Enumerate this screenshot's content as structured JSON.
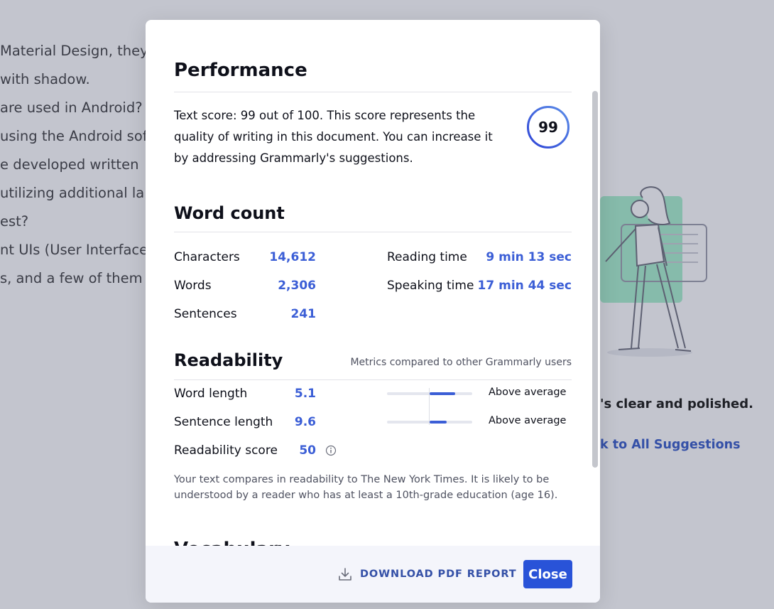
{
  "background": {
    "document_lines": [
      "Material Design, they",
      "with shadow.",
      "are used in Android?",
      "using the Android sof",
      "e developed written",
      "utilizing additional lar",
      "est?",
      "nt UIs (User Interface",
      "s, and a few of them"
    ],
    "status_message": "'s clear and polished.",
    "back_link": "k to All Suggestions"
  },
  "modal": {
    "performance": {
      "title": "Performance",
      "description": "Text score: 99 out of 100. This score represents the quality of writing in this document. You can increase it by addressing Grammarly's suggestions.",
      "score": "99",
      "score_fraction": 0.99
    },
    "word_count": {
      "title": "Word count",
      "stats": [
        {
          "label": "Characters",
          "value": "14,612"
        },
        {
          "label": "Words",
          "value": "2,306"
        },
        {
          "label": "Sentences",
          "value": "241"
        }
      ],
      "times": [
        {
          "label": "Reading time",
          "value": "9 min 13 sec"
        },
        {
          "label": "Speaking time",
          "value": "17 min 44 sec"
        }
      ]
    },
    "readability": {
      "title": "Readability",
      "caption": "Metrics compared to other Grammarly users",
      "metrics": [
        {
          "label": "Word length",
          "value": "5.1",
          "rating": "Above average",
          "bar_from": 0.5,
          "bar_to": 0.8
        },
        {
          "label": "Sentence length",
          "value": "9.6",
          "rating": "Above average",
          "bar_from": 0.5,
          "bar_to": 0.7
        }
      ],
      "score_label": "Readability score",
      "score_value": "50",
      "note": "Your text compares in readability to The New York Times. It is likely to be understood by a reader who has at least a 10th-grade education (age 16)."
    },
    "next_section_title": "Vocabulary",
    "footer": {
      "download_label": "DOWNLOAD PDF REPORT",
      "close_label": "Close"
    }
  },
  "colors": {
    "accent": "#3b5ed6",
    "button": "#2953d8",
    "overlay": "#c3c5ce"
  }
}
